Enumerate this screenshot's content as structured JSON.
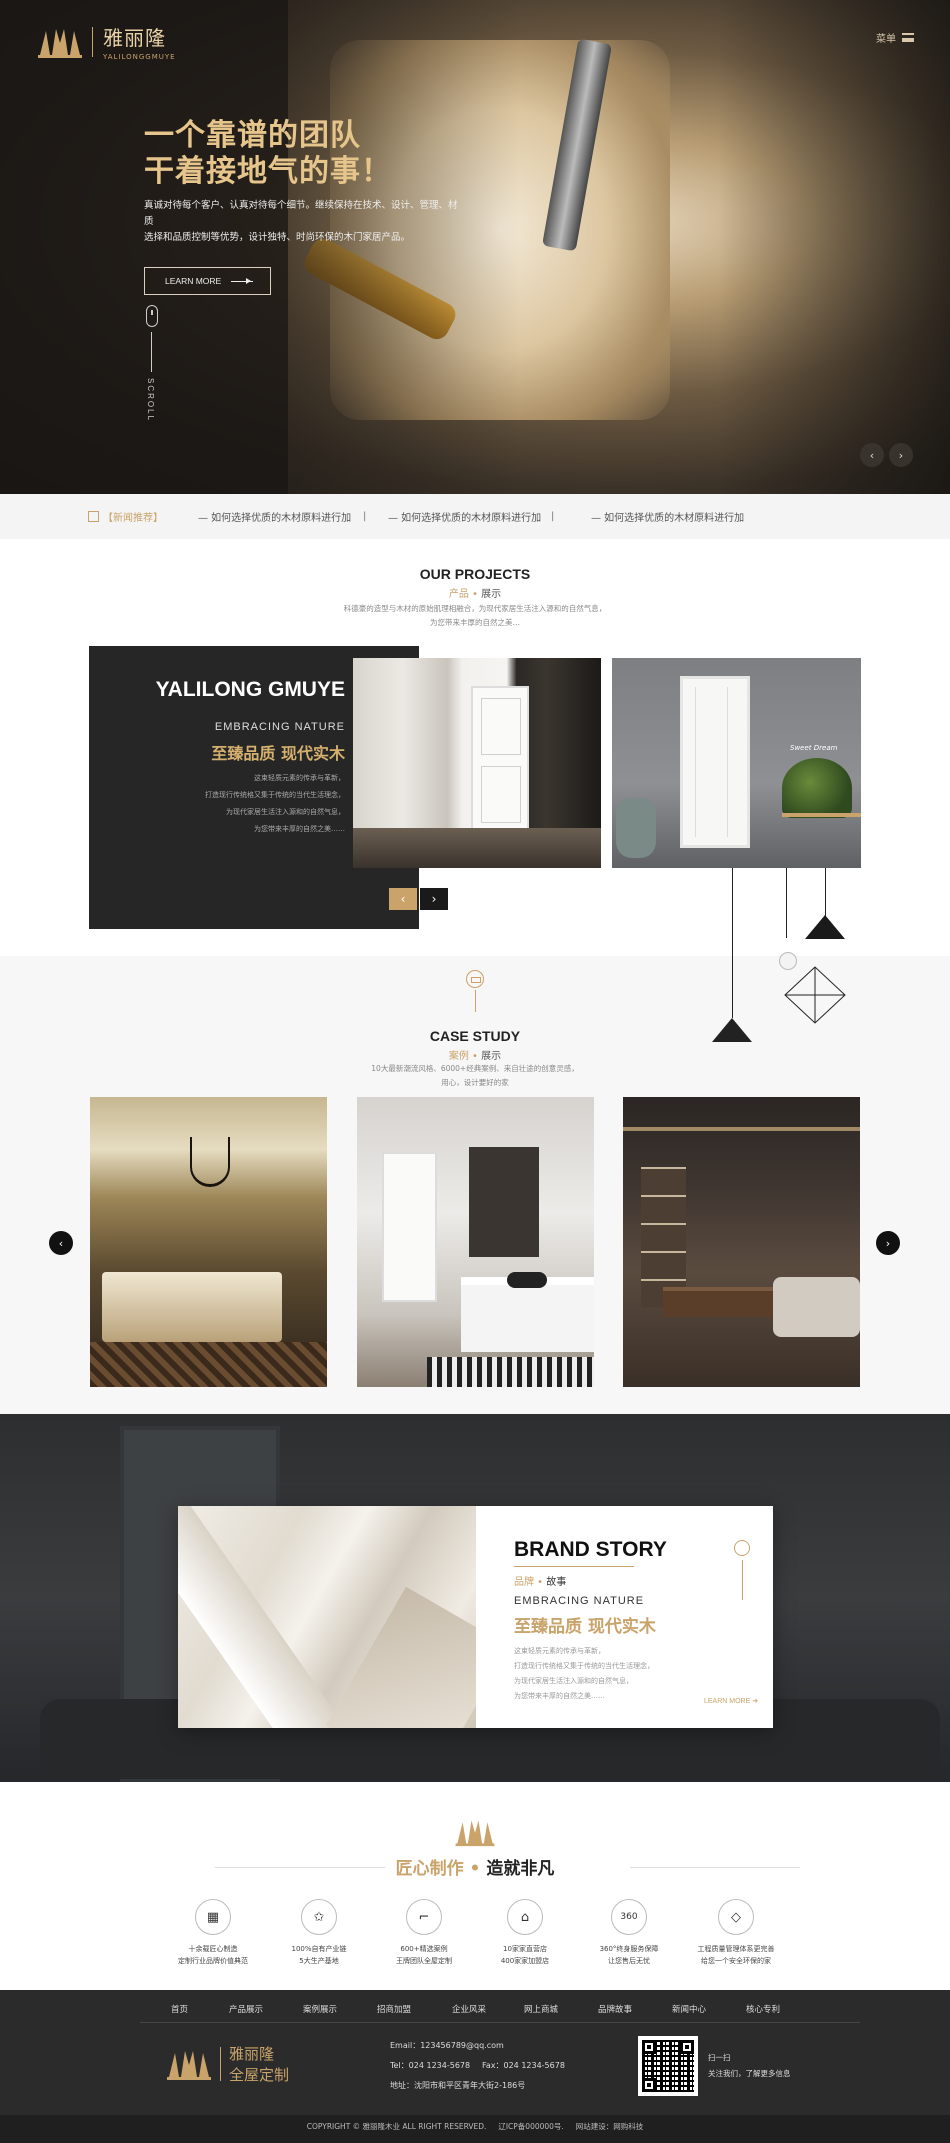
{
  "header": {
    "logo_cn": "雅丽隆",
    "logo_en": "YALILONGGMUYE",
    "menu_label": "菜单"
  },
  "hero": {
    "title_line1": "一个靠谱的团队",
    "title_line2": "干着接地气的事！",
    "desc_line1": "真诚对待每个客户、认真对待每个细节。继续保持在技术、设计、管理、材质",
    "desc_line2": "选择和品质控制等优势，设计独特、时尚环保的木门家居产品。",
    "learn_more": "LEARN MORE",
    "scroll_label": "SCROLL",
    "prev_icon": "‹",
    "next_icon": "›"
  },
  "news": {
    "tag": "【新闻推荐】",
    "items": [
      "— 如何选择优质的木材原料进行加",
      "— 如何选择优质的木材原料进行加",
      "— 如何选择优质的木材原料进行加"
    ],
    "separator": "|"
  },
  "projects": {
    "title": "OUR PROJECTS",
    "sub_gold": "产品",
    "sub_dot": " • ",
    "sub_text": "展示",
    "desc_line1": "科德豪的造型与木材的原始肌理相融合，为现代家居生活注入源和的自然气息，",
    "desc_line2": "为您带来丰厚的自然之美…",
    "brand": "YALILONG GMUYE",
    "embrace": "EMBRACING NATURE",
    "cn_slogan": "至臻品质 现代实木",
    "desc": [
      "这束轻质元素的传承与革新，",
      "打造现行传统格又集于传统的当代生活理念，",
      "为现代家居生活注入源和的自然气息，",
      "为您带来丰厚的自然之美……"
    ],
    "sign_text": "Sweet Dream",
    "prev": "‹",
    "next": "›"
  },
  "case_study": {
    "title": "CASE STUDY",
    "sub_gold": "案例",
    "sub_dot": " • ",
    "sub_text": "展示",
    "desc_line1": "10大最新潮流风格、6000+经典案例、来自壮途的创意灵感，",
    "desc_line2": "用心，设计要好的家",
    "prev": "‹",
    "next": "›"
  },
  "brand_story": {
    "title": "BRAND STORY",
    "sub_gold": "品牌",
    "sub_dot": " • ",
    "sub_text": "故事",
    "embrace": "EMBRACING NATURE",
    "cn_slogan": "至臻品质 现代实木",
    "desc": [
      "这束轻质元素的传承与革新，",
      "打造现行传统格又集于传统的当代生活理念，",
      "为现代家居生活注入源和的自然气息，",
      "为您带来丰厚的自然之美……"
    ],
    "more": "LEARN MORE ➔"
  },
  "craft": {
    "title_gold": "匠心制作",
    "title_dot": " • ",
    "title_text": "造就非凡",
    "features": [
      {
        "icon": "▦",
        "line1": "十余载匠心制造",
        "line2": "定制行业品牌价值典范"
      },
      {
        "icon": "✩",
        "line1": "100%自有产业链",
        "line2": "5大生产基地"
      },
      {
        "icon": "⌐",
        "line1": "600+精选案例",
        "line2": "王牌团队全屋定制"
      },
      {
        "icon": "⌂",
        "line1": "10家家直营店",
        "line2": "400家家加盟店"
      },
      {
        "icon": "360",
        "line1": "360°终身服务保障",
        "line2": "让您售后无忧"
      },
      {
        "icon": "◇",
        "line1": "工程质量管理体系更完善",
        "line2": "给您一个安全环保的家"
      }
    ]
  },
  "footer": {
    "nav": [
      "首页",
      "产品展示",
      "案例展示",
      "招商加盟",
      "企业风采",
      "网上商城",
      "品牌故事",
      "新闻中心",
      "核心专利"
    ],
    "logo_cn": "雅丽隆",
    "logo_sub": "全屋定制",
    "email": "Email：123456789@qq.com",
    "tel": "Tel：024 1234-5678",
    "fax": "Fax：024 1234-5678",
    "address": "地址：沈阳市和平区青年大街2-186号",
    "qr_title": "扫一扫",
    "qr_desc": "关注我们，了解更多信息",
    "copyright": "COPYRIGHT © 雅丽隆木业 ALL RIGHT RESERVED.     辽ICP备000000号.     网站建设：网购科技"
  },
  "colors": {
    "gold": "#c9a36a",
    "dark": "#262626",
    "footer": "#2b2b2b"
  }
}
